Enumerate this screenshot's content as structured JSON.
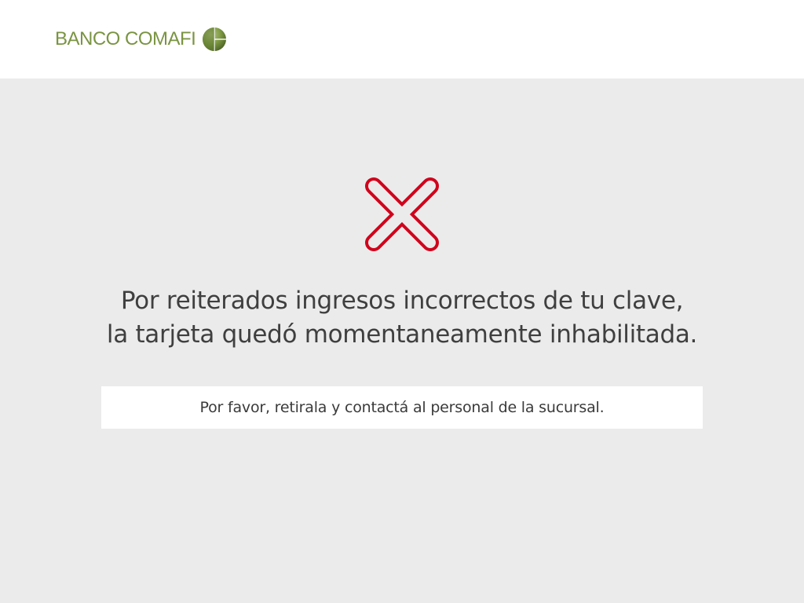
{
  "header": {
    "logo_text": "BANCO COMAFI",
    "logo_icon": "comafi-globe-logo",
    "brand_color": "#7a9442"
  },
  "main": {
    "status_icon": "error-x-icon",
    "error_color": "#d0021b",
    "message_line1": "Por reiterados ingresos incorrectos de tu clave,",
    "message_line2": "la tarjeta quedó momentaneamente inhabilitada.",
    "instruction": "Por favor, retirala y contactá al personal de la sucursal."
  }
}
